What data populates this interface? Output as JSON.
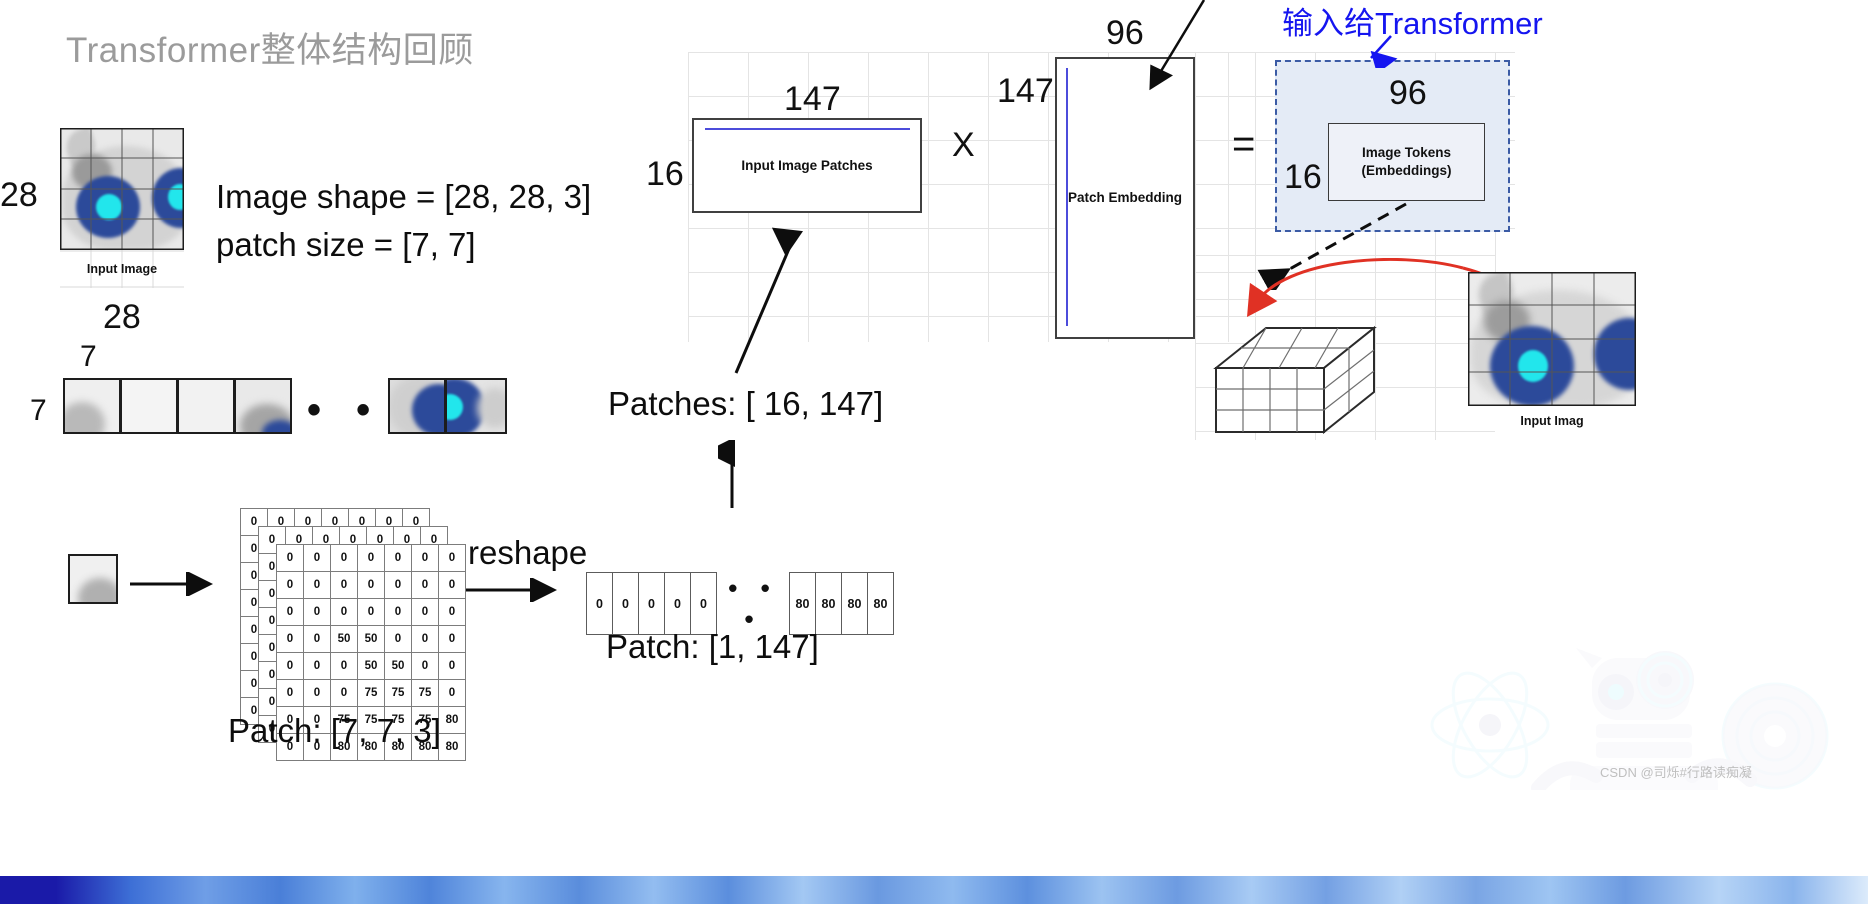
{
  "slide": {
    "title": "Transformer整体结构回顾"
  },
  "left_panel": {
    "input_image_caption": "Input Image",
    "dim_height": "28",
    "dim_width": "28",
    "equation_1": "Image shape = [28, 28, 3]",
    "equation_2": "patch size = [7, 7]",
    "patch_dim_height": "7",
    "patch_dim_width": "7",
    "strip_dots": "• • •"
  },
  "patch_matrix": {
    "caption": "Patch: [7, 7, 3]",
    "rows": [
      [
        "0",
        "0",
        "0",
        "0",
        "0",
        "0",
        "0"
      ],
      [
        "0",
        "0",
        "0",
        "0",
        "0",
        "0",
        "0"
      ],
      [
        "0",
        "0",
        "0",
        "0",
        "0",
        "0",
        "0"
      ],
      [
        "0",
        "0",
        "50",
        "50",
        "0",
        "0",
        "0"
      ],
      [
        "0",
        "0",
        "0",
        "50",
        "50",
        "0",
        "0"
      ],
      [
        "0",
        "0",
        "0",
        "75",
        "75",
        "75",
        "0"
      ],
      [
        "0",
        "0",
        "75",
        "75",
        "75",
        "75",
        "80"
      ],
      [
        "0",
        "0",
        "80",
        "80",
        "80",
        "80",
        "80"
      ]
    ]
  },
  "reshape": {
    "label": "reshape",
    "result_caption": "Patch: [1, 147]",
    "vector_head": [
      "0",
      "0",
      "0",
      "0",
      "0"
    ],
    "vector_gap": "• • •",
    "vector_tail": [
      "80",
      "80",
      "80",
      "80"
    ]
  },
  "patches_label": "Patches: [ 16, 147]",
  "matmul": {
    "lhs": {
      "label": "Input Image Patches",
      "cols": "147",
      "rows": "16"
    },
    "operator_times": "X",
    "rhs": {
      "label": "Patch Embedding",
      "cols": "96",
      "rows": "147"
    },
    "operator_equals": "=",
    "result": {
      "label_line1": "Image Tokens",
      "label_line2": "(Embeddings)",
      "cols": "96",
      "rows": "16"
    }
  },
  "annotation": {
    "transformer_input": "输入给Transformer"
  },
  "right_panel": {
    "input_image_caption": "Input Imag"
  },
  "watermark": {
    "text": "CSDN @司烁#行路读痴凝"
  },
  "colors": {
    "annotation_blue": "#1515f0",
    "dashed_border": "#3b5ba5",
    "dashed_fill": "#e4ebf6",
    "arrow_red": "#e03124",
    "matrix_line_blue": "#4c4cdb",
    "title_gray": "#9b9b9b"
  }
}
